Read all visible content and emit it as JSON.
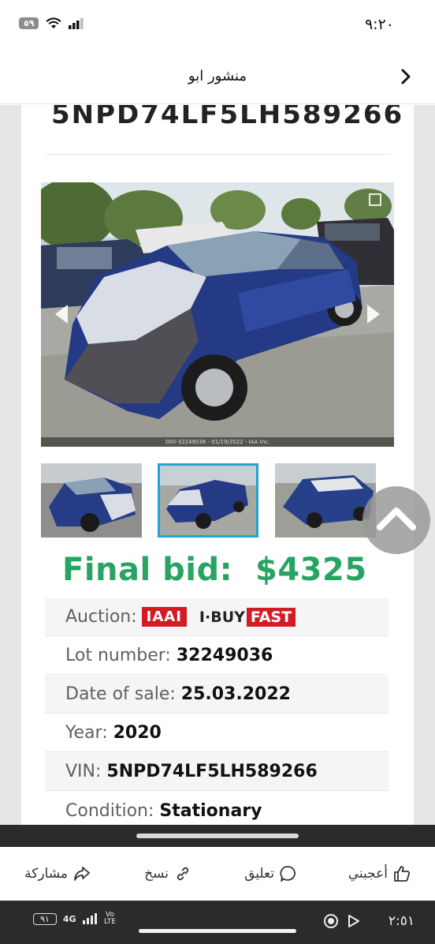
{
  "status_bar": {
    "time": "٩:٢٠",
    "battery": "٥٩"
  },
  "header": {
    "title": "منشور ابو"
  },
  "listing": {
    "vin_heading": "5NPD74LF5LH589266",
    "photo_caption": "000-32249036 - 01/19/2022 - IAA Inc.",
    "final_bid_label": "Final bid:",
    "final_bid_value": "$4325",
    "rows": [
      {
        "label": "Auction:",
        "value": ""
      },
      {
        "label": "Lot number:",
        "value": "32249036"
      },
      {
        "label": "Date of sale:",
        "value": "25.03.2022"
      },
      {
        "label": "Year:",
        "value": "2020"
      },
      {
        "label": "VIN:",
        "value": "5NPD74LF5LH589266"
      },
      {
        "label": "Condition:",
        "value": "Stationary"
      }
    ],
    "auction_logo_iaai": "IAAI",
    "auction_logo_ibuy": "I·BUY",
    "auction_logo_fast": "FAST"
  },
  "actions": {
    "like": "أعجبني",
    "comment": "تعليق",
    "copy": "نسخ",
    "share": "مشاركة"
  },
  "system_bar": {
    "time": "٢:٥١",
    "battery": "٩١",
    "network": "4G",
    "volte": "Vo LTE"
  },
  "colors": {
    "final_bid_green": "#27a462",
    "iaai_red": "#d31b24",
    "thumb_selected": "#22a3d4"
  }
}
